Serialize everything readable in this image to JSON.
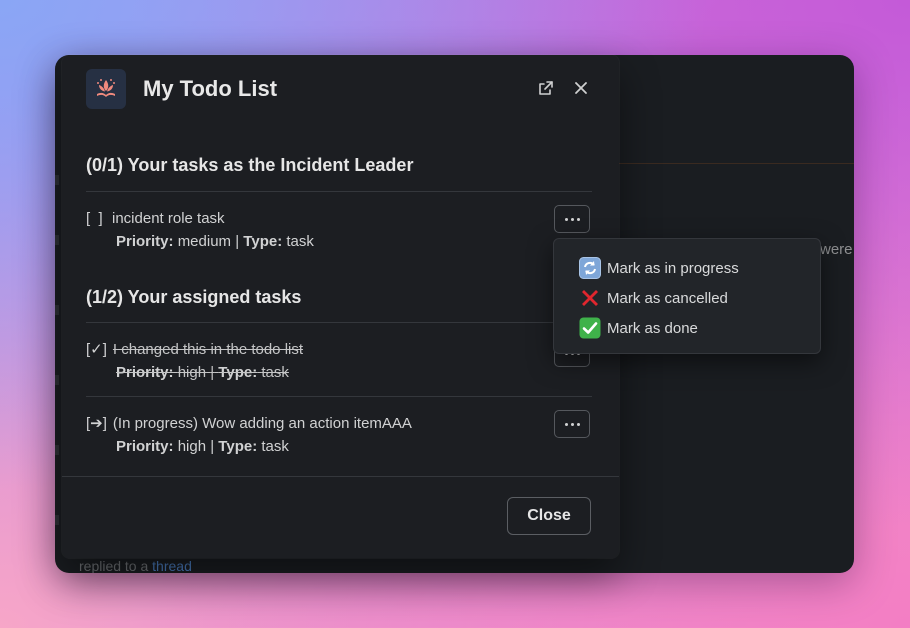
{
  "background": {
    "were_text": "were",
    "footer_prefix": "replied to a",
    "footer_link": "thread"
  },
  "modal": {
    "title": "My Todo List",
    "close_label": "Close"
  },
  "sections": [
    {
      "heading": "(0/1) Your tasks as the Incident Leader"
    },
    {
      "heading": "(1/2) Your assigned tasks"
    }
  ],
  "tasks": [
    {
      "checkbox": "[  ]",
      "title": "incident role task",
      "priority_label": "Priority:",
      "priority": "medium",
      "separator": "|",
      "type_label": "Type:",
      "type": "task",
      "state": "open"
    },
    {
      "checkbox": "[✓]",
      "title": "I changed this in the todo list",
      "priority_label": "Priority:",
      "priority": "high",
      "separator": "|",
      "type_label": "Type:",
      "type": "task",
      "state": "done"
    },
    {
      "checkbox": "[➔]",
      "title": "(In progress) Wow adding an action itemAAA",
      "priority_label": "Priority:",
      "priority": "high",
      "separator": "|",
      "type_label": "Type:",
      "type": "task",
      "state": "in-progress"
    }
  ],
  "context_menu": {
    "items": [
      {
        "label": "Mark as in progress",
        "icon": "arrows-refresh-icon"
      },
      {
        "label": "Mark as cancelled",
        "icon": "red-x-icon"
      },
      {
        "label": "Mark as done",
        "icon": "green-check-icon"
      }
    ]
  },
  "colors": {
    "modal_bg": "#1c1e22",
    "text": "#d1d2d3",
    "menu_bg": "#222529"
  }
}
